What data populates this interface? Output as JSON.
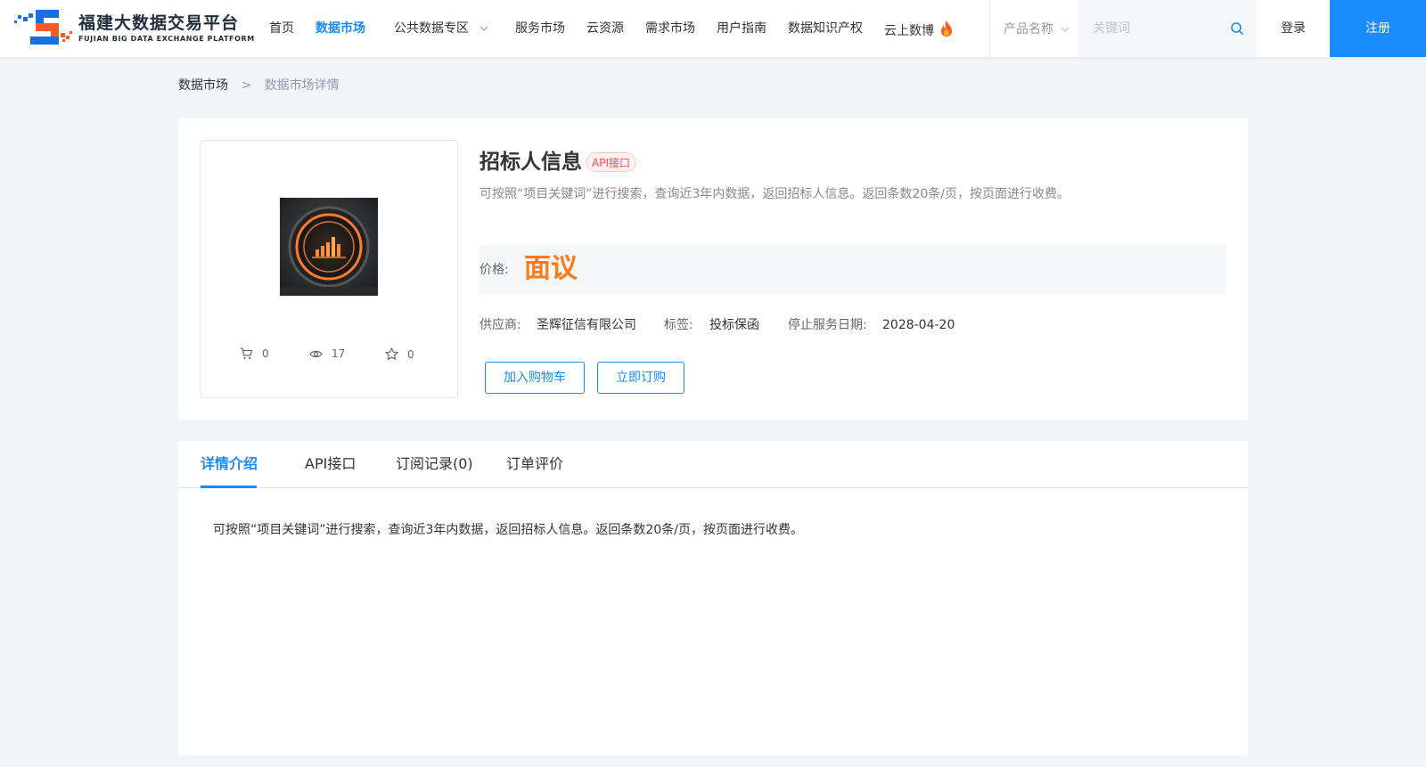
{
  "header": {
    "logo": {
      "cn": "福建大数据交易平台",
      "en": "FUJIAN BIG DATA EXCHANGE  PLATFORM"
    },
    "nav": {
      "home": "首页",
      "data_market": "数据市场",
      "public_data": "公共数据专区",
      "service_market": "服务市场",
      "cloud_resource": "云资源",
      "demand_market": "需求市场",
      "user_guide": "用户指南",
      "data_ip": "数据知识产权",
      "cloud_expo": "云上数博"
    },
    "search": {
      "category": "产品名称",
      "placeholder": "关键词",
      "value": ""
    },
    "login": "登录",
    "register": "注册"
  },
  "breadcrumb": {
    "parent": "数据市场",
    "separator": ">",
    "current": "数据市场详情"
  },
  "product": {
    "title": "招标人信息",
    "type_tag": "API接口",
    "description": "可按照“项目关键词”进行搜索，查询近3年内数据，返回招标人信息。返回条数20条/页，按页面进行收费。",
    "price_label": "价格:",
    "price_value": "面议",
    "supplier_label": "供应商:",
    "supplier": "圣辉征信有限公司",
    "tag_label": "标签:",
    "tag": "投标保函",
    "end_date_label": "停止服务日期:",
    "end_date": "2028-04-20",
    "stats": {
      "cart": "0",
      "views": "17",
      "favorites": "0"
    },
    "add_to_cart": "加入购物车",
    "subscribe_now": "立即订购"
  },
  "tabs": {
    "items": [
      "详情介绍",
      "API接口",
      "订阅记录(0)",
      "订单评价"
    ],
    "active_index": 0
  },
  "detail": {
    "text": "可按照“项目关键词”进行搜索，查询近3年内数据，返回招标人信息。返回条数20条/页，按页面进行收费。"
  },
  "colors": {
    "primary": "#1a8cff",
    "price": "#ff7a1a",
    "tag": "#ff4d4f",
    "background": "#f2f4f7"
  },
  "icons": {
    "cart": "cart-icon",
    "views": "eye-icon",
    "favorites": "star-icon",
    "search": "search-icon",
    "dropdown": "chevron-down-icon",
    "hot": "fire-icon"
  }
}
